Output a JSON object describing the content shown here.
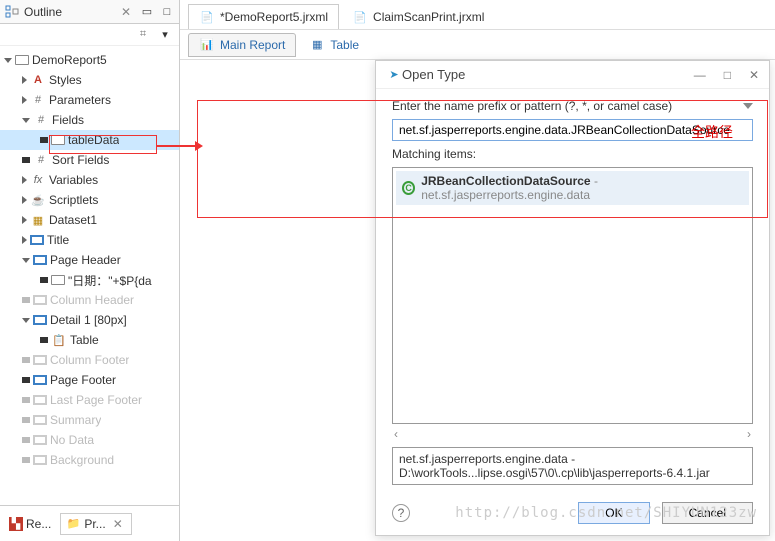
{
  "outline": {
    "title": "Outline",
    "root": "DemoReport5",
    "items": {
      "styles": "Styles",
      "parameters": "Parameters",
      "fields": "Fields",
      "tableData": "tableData",
      "sortFields": "Sort Fields",
      "variables": "Variables",
      "scriptlets": "Scriptlets",
      "dataset1": "Dataset1",
      "title": "Title",
      "pageHeader": "Page Header",
      "dateExpr": "\"日期：\"+$P{da",
      "columnHeader": "Column Header",
      "detail": "Detail 1 [80px]",
      "table": "Table",
      "columnFooter": "Column Footer",
      "pageFooter": "Page Footer",
      "lastPageFooter": "Last Page Footer",
      "summary": "Summary",
      "noData": "No Data",
      "background": "Background"
    }
  },
  "bottomTabs": {
    "re": "Re...",
    "pr": "Pr..."
  },
  "editorTabs": {
    "demo": "*DemoReport5.jrxml",
    "claim": "ClaimScanPrint.jrxml"
  },
  "reportTabs": {
    "main": "Main Report",
    "table": "Table"
  },
  "dialog": {
    "title": "Open Type",
    "prompt": "Enter the name prefix or pattern (?, *, or camel case)",
    "input": "net.sf.jasperreports.engine.data.JRBeanCollectionDataSource",
    "annotation": "全路径",
    "matchingLabel": "Matching items:",
    "result": {
      "main": "JRBeanCollectionDataSource",
      "sep": " - ",
      "sub": "net.sf.jasperreports.engine.data"
    },
    "path": "net.sf.jasperreports.engine.data - D:\\workTools...lipse.osgi\\57\\0\\.cp\\lib\\jasperreports-6.4.1.jar",
    "ok": "OK",
    "cancel": "Cancel",
    "scrollLeft": "‹",
    "scrollRight": "›"
  },
  "watermark": "http://blog.csdn.net/SHIYUN123zw"
}
